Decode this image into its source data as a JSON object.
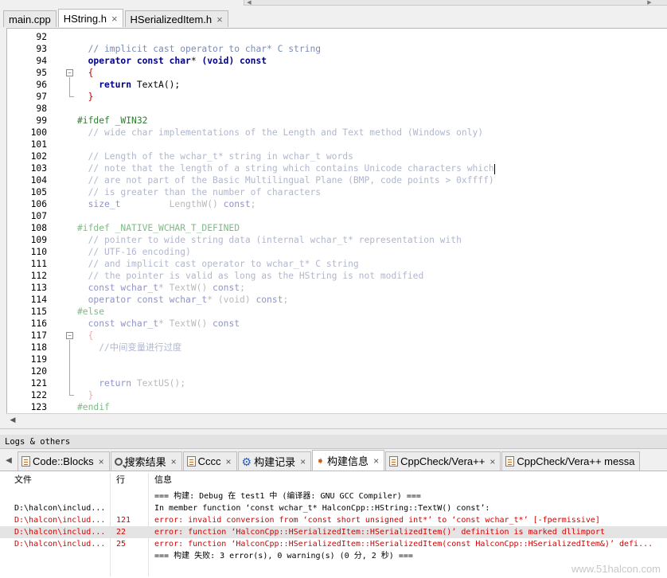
{
  "editor_tabs": [
    {
      "label": "main.cpp",
      "active": false
    },
    {
      "label": "HString.h",
      "active": true,
      "close": "×"
    },
    {
      "label": "HSerializedItem.h",
      "active": false,
      "close": "×"
    }
  ],
  "code_lines": [
    {
      "n": "92",
      "segs": []
    },
    {
      "n": "93",
      "segs": [
        {
          "c": "t-comment",
          "t": "  // implicit cast operator to char* C string"
        }
      ]
    },
    {
      "n": "94",
      "segs": [
        {
          "c": "t-kw",
          "t": "  operator const char"
        },
        {
          "c": "t-id",
          "t": "* "
        },
        {
          "c": "t-kw",
          "t": "(void) const"
        }
      ]
    },
    {
      "n": "95",
      "segs": [
        {
          "c": "t-brace",
          "t": "  {"
        }
      ]
    },
    {
      "n": "96",
      "segs": [
        {
          "c": "t-kw",
          "t": "    return "
        },
        {
          "c": "t-id",
          "t": "TextA();"
        }
      ]
    },
    {
      "n": "97",
      "segs": [
        {
          "c": "t-brace",
          "t": "  }"
        }
      ]
    },
    {
      "n": "98",
      "segs": []
    },
    {
      "n": "99",
      "segs": [
        {
          "c": "t-pp",
          "t": "#ifdef _WIN32"
        }
      ]
    },
    {
      "n": "100",
      "segs": [
        {
          "c": "t-dimcm",
          "t": "  // wide char implementations of the Length and Text method (Windows only)"
        }
      ]
    },
    {
      "n": "101",
      "segs": []
    },
    {
      "n": "102",
      "segs": [
        {
          "c": "t-dimcm",
          "t": "  // Length of the wchar_t* string in wchar_t words"
        }
      ]
    },
    {
      "n": "103",
      "segs": [
        {
          "c": "t-dimcm",
          "t": "  // note that the length of a string which contains Unicode characters which"
        }
      ],
      "caret": true
    },
    {
      "n": "104",
      "segs": [
        {
          "c": "t-dimcm",
          "t": "  // are not part of the Basic Multilingual Plane (BMP, code points > 0xffff)"
        }
      ]
    },
    {
      "n": "105",
      "segs": [
        {
          "c": "t-dimcm",
          "t": "  // is greater than the number of characters"
        }
      ]
    },
    {
      "n": "106",
      "segs": [
        {
          "c": "t-dimkw",
          "t": "  size_t"
        },
        {
          "c": "t-dim",
          "t": "         LengthW() "
        },
        {
          "c": "t-dimkw",
          "t": "const"
        },
        {
          "c": "t-dim",
          "t": ";"
        }
      ]
    },
    {
      "n": "107",
      "segs": []
    },
    {
      "n": "108",
      "segs": [
        {
          "c": "t-dimpp",
          "t": "#ifdef _NATIVE_WCHAR_T_DEFINED"
        }
      ]
    },
    {
      "n": "109",
      "segs": [
        {
          "c": "t-dimcm",
          "t": "  // pointer to wide string data (internal wchar_t* representation with"
        }
      ]
    },
    {
      "n": "110",
      "segs": [
        {
          "c": "t-dimcm",
          "t": "  // UTF-16 encoding)"
        }
      ]
    },
    {
      "n": "111",
      "segs": [
        {
          "c": "t-dimcm",
          "t": "  // and implicit cast operator to wchar_t* C string"
        }
      ]
    },
    {
      "n": "112",
      "segs": [
        {
          "c": "t-dimcm",
          "t": "  // the pointer is valid as long as the HString is not modified"
        }
      ]
    },
    {
      "n": "113",
      "segs": [
        {
          "c": "t-dimkw",
          "t": "  const wchar_t"
        },
        {
          "c": "t-dim",
          "t": "* TextW() "
        },
        {
          "c": "t-dimkw",
          "t": "const"
        },
        {
          "c": "t-dim",
          "t": ";"
        }
      ]
    },
    {
      "n": "114",
      "segs": [
        {
          "c": "t-dimkw",
          "t": "  operator const wchar_t"
        },
        {
          "c": "t-dim",
          "t": "* (void) "
        },
        {
          "c": "t-dimkw",
          "t": "const"
        },
        {
          "c": "t-dim",
          "t": ";"
        }
      ]
    },
    {
      "n": "115",
      "segs": [
        {
          "c": "t-dimpp",
          "t": "#else"
        }
      ]
    },
    {
      "n": "116",
      "segs": [
        {
          "c": "t-dimkw",
          "t": "  const wchar_t"
        },
        {
          "c": "t-dim",
          "t": "* TextW() "
        },
        {
          "c": "t-dimkw",
          "t": "const"
        }
      ]
    },
    {
      "n": "117",
      "segs": [
        {
          "c": "t-dimbr",
          "t": "  {"
        }
      ]
    },
    {
      "n": "118",
      "segs": [
        {
          "c": "t-dimcm",
          "t": "    //中间变量进行过度"
        }
      ]
    },
    {
      "n": "119",
      "segs": []
    },
    {
      "n": "120",
      "segs": []
    },
    {
      "n": "121",
      "segs": [
        {
          "c": "t-dimkw",
          "t": "    return "
        },
        {
          "c": "t-dim",
          "t": "TextUS();"
        }
      ]
    },
    {
      "n": "122",
      "segs": [
        {
          "c": "t-dimbr",
          "t": "  }"
        }
      ]
    },
    {
      "n": "123",
      "segs": [
        {
          "c": "t-dimpp",
          "t": "#endif"
        }
      ]
    }
  ],
  "logs": {
    "title": "Logs & others",
    "tabs": [
      {
        "label": "Code::Blocks",
        "icon": "document-icon",
        "active": false,
        "close": "×"
      },
      {
        "label": "搜索结果",
        "icon": "search-icon",
        "active": false,
        "close": "×"
      },
      {
        "label": "Cccc",
        "icon": "document-icon",
        "active": false,
        "close": "×"
      },
      {
        "label": "构建记录",
        "icon": "gear-icon",
        "active": false,
        "close": "×"
      },
      {
        "label": "构建信息",
        "icon": "pin-icon",
        "active": true,
        "close": "×"
      },
      {
        "label": "CppCheck/Vera++",
        "icon": "document-icon",
        "active": false,
        "close": "×"
      },
      {
        "label": "CppCheck/Vera++ messa",
        "icon": "document-icon",
        "active": false,
        "close": ""
      }
    ],
    "columns": {
      "file": "文件",
      "line": "行",
      "message": "信息"
    },
    "rows": [
      {
        "file": "",
        "line": "",
        "message": "=== 构建: Debug 在 test1 中 (编译器: GNU GCC Compiler) ===",
        "type": "info"
      },
      {
        "file": "D:\\halcon\\includ...",
        "line": "",
        "message": "In member function ‘const wchar_t* HalconCpp::HString::TextW() const’:",
        "type": "info"
      },
      {
        "file": "D:\\halcon\\includ...",
        "line": "121",
        "message": "error: invalid conversion from ‘const short unsigned int*’ to ‘const wchar_t*’ [-fpermissive]",
        "type": "error"
      },
      {
        "file": "D:\\halcon\\includ...",
        "line": "22",
        "message": "error: function ‘HalconCpp::HSerializedItem::HSerializedItem()’ definition is marked dllimport",
        "type": "error",
        "selected": true
      },
      {
        "file": "D:\\halcon\\includ...",
        "line": "25",
        "message": "error: function ‘HalconCpp::HSerializedItem::HSerializedItem(const HalconCpp::HSerializedItem&)’ defi...",
        "type": "error"
      },
      {
        "file": "",
        "line": "",
        "message": "=== 构建 失败: 3 error(s), 0 warning(s) (0 分, 2 秒) ===",
        "type": "info"
      }
    ]
  },
  "watermark": "www.51halcon.com"
}
